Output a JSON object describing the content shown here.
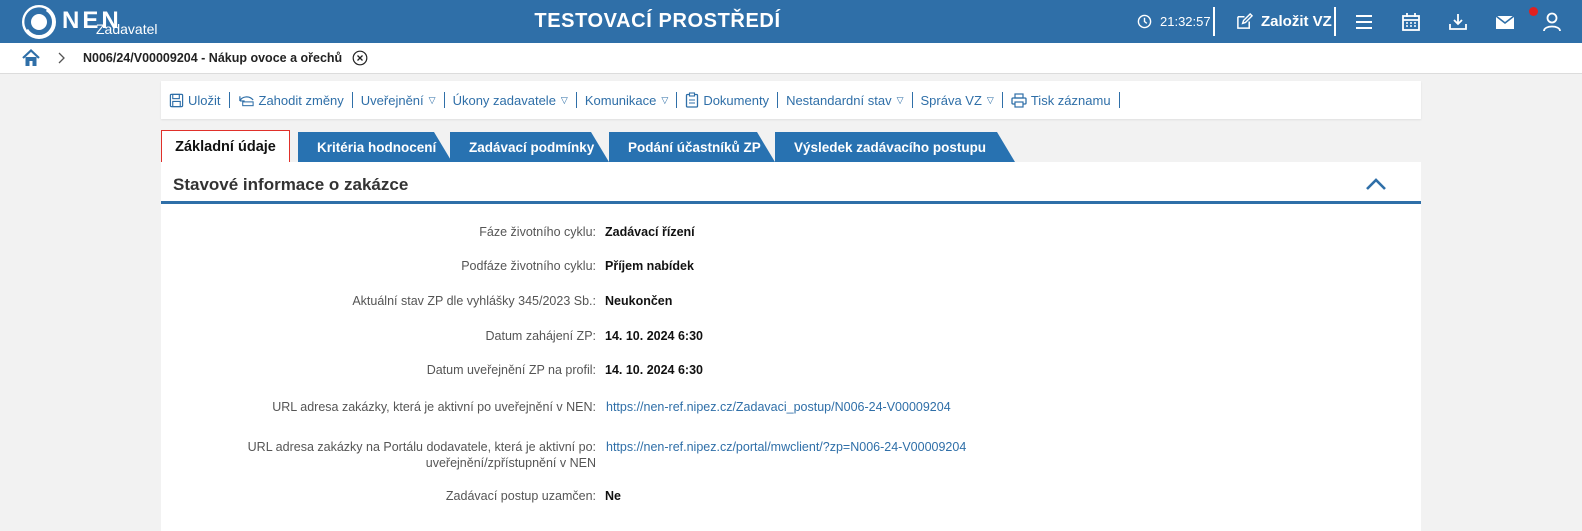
{
  "header": {
    "logo_text": "NEN",
    "logo_sub": "Zadavatel",
    "env_title": "TESTOVACÍ PROSTŘEDÍ",
    "clock": "21:32:57",
    "create_label": "Založit VZ",
    "accent": "#2f6fa8",
    "notification_color": "#e02020"
  },
  "breadcrumb": {
    "current": "N006/24/V00009204 - Nákup ovoce a ořechů"
  },
  "toolbar": {
    "save": "Uložit",
    "discard": "Zahodit změny",
    "publish": "Uveřejnění",
    "actions": "Úkony zadavatele",
    "communication": "Komunikace",
    "documents": "Dokumenty",
    "nonstandard": "Nestandardní stav",
    "management": "Správa VZ",
    "print": "Tisk záznamu",
    "caret": "▽"
  },
  "tabs": [
    {
      "label": "Základní údaje"
    },
    {
      "label": "Kritéria hodnocení"
    },
    {
      "label": "Zadávací podmínky"
    },
    {
      "label": "Podání účastníků ZP"
    },
    {
      "label": "Výsledek zadávacího postupu"
    }
  ],
  "panel": {
    "title": "Stavové informace o zakázce",
    "fields": [
      {
        "label": "Fáze životního cyklu:",
        "value": "Zadávací řízení"
      },
      {
        "label": "Podfáze životního cyklu:",
        "value": "Příjem nabídek"
      },
      {
        "label": "Aktuální stav ZP dle vyhlášky 345/2023 Sb.:",
        "value": "Neukončen"
      },
      {
        "label": "Datum zahájení ZP:",
        "value": "14. 10. 2024 6:30"
      },
      {
        "label": "Datum uveřejnění ZP na profil:",
        "value": "14. 10. 2024 6:30"
      },
      {
        "label": "URL adresa zakázky, která je aktivní po uveřejnění v NEN:",
        "value": "https://nen-ref.nipez.cz/Zadavaci_postup/N006-24-V00009204"
      },
      {
        "label": "URL adresa zakázky na Portálu dodavatele, která je aktivní po:",
        "label2": "uveřejnění/zpřístupnění v NEN",
        "value": "https://nen-ref.nipez.cz/portal/mwclient/?zp=N006-24-V00009204"
      },
      {
        "label": "Zadávací postup uzamčen:",
        "value": "Ne"
      }
    ]
  }
}
